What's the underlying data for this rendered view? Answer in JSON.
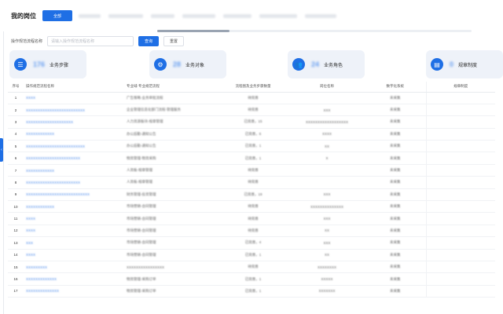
{
  "header": {
    "title": "我的岗位",
    "active_tab": "全部",
    "ghost_tabs": 7
  },
  "filter": {
    "label": "操作规范流程名称",
    "placeholder": "请输入操作规范流程名称",
    "query_label": "查询",
    "reset_label": "重置"
  },
  "cards": [
    {
      "label": "业务步骤",
      "number": "176",
      "icon": "steps-icon"
    },
    {
      "label": "业务对象",
      "number": "28",
      "icon": "object-icon"
    },
    {
      "label": "业务角色",
      "number": "24",
      "icon": "role-icon"
    },
    {
      "label": "规章制度",
      "number": "0",
      "icon": "document-icon"
    }
  ],
  "table": {
    "columns": [
      "序号",
      "操作规范流程名称",
      "专业域-专业规范流程",
      "流程图及业务步骤数量",
      "岗位名称",
      "数字化系统",
      "规章制度"
    ],
    "rows": [
      {
        "index": "1",
        "name": "XXXX",
        "domain": "广告策略-业务审批流程",
        "steps": "待完善",
        "role": "",
        "system": "未采集",
        "rule": ""
      },
      {
        "index": "2",
        "name": "XXXXXXXXXXXXXXXXXXXXXXXXX",
        "domain": "企业管理信息化部门流程-管理服务",
        "steps": "待完善",
        "role": "XXX",
        "system": "未采集",
        "rule": ""
      },
      {
        "index": "3",
        "name": "XXXXXXXXXXXXXXXXXXXX",
        "domain": "人力资源板块-规章管理",
        "steps": "已完善，15",
        "role": "XXXXXXXXXXXXXXXXXX",
        "system": "未采集",
        "rule": ""
      },
      {
        "index": "4",
        "name": "XXXXXXXXXXXX",
        "domain": "办公后勤-通知公告",
        "steps": "已完善，6",
        "role": "XXXX",
        "system": "未采集",
        "rule": ""
      },
      {
        "index": "5",
        "name": "XXXXXXXXXXXXXXXXXXXXXXXXX",
        "domain": "办公后勤-通知公告",
        "steps": "已完善，1",
        "role": "XX",
        "system": "未采集",
        "rule": ""
      },
      {
        "index": "6",
        "name": "XXXXXXXXXXXXXXXXXXXXXXX",
        "domain": "物资管理-物资采购",
        "steps": "已完善，1",
        "role": "X",
        "system": "未采集",
        "rule": ""
      },
      {
        "index": "7",
        "name": "XXXXXXXXXXXX",
        "domain": "人资板-规章管理",
        "steps": "待完善",
        "role": "",
        "system": "未采集",
        "rule": ""
      },
      {
        "index": "8",
        "name": "XXXXXXXXXXXXXXXXXXXXXXX",
        "domain": "人资板-规章管理",
        "steps": "待完善",
        "role": "",
        "system": "未采集",
        "rule": ""
      },
      {
        "index": "9",
        "name": "XXXXXXXXXXXXXXXXXXXXXXXXXXX",
        "domain": "财务管理-投资管理",
        "steps": "已完善，19",
        "role": "XXX",
        "system": "未采集",
        "rule": ""
      },
      {
        "index": "10",
        "name": "XXXXXXXXXXXX",
        "domain": "市场营销-合同管理",
        "steps": "待完善",
        "role": "XXXXXXXXXXXXXX",
        "system": "未采集",
        "rule": ""
      },
      {
        "index": "11",
        "name": "XXXX",
        "domain": "市场营销-合同管理",
        "steps": "待完善",
        "role": "XXX",
        "system": "未采集",
        "rule": ""
      },
      {
        "index": "12",
        "name": "XXXX",
        "domain": "市场营销-合同管理",
        "steps": "待完善",
        "role": "XX",
        "system": "未采集",
        "rule": ""
      },
      {
        "index": "13",
        "name": "XXX",
        "domain": "市场营销-合同管理",
        "steps": "已完善，4",
        "role": "XXX",
        "system": "未采集",
        "rule": ""
      },
      {
        "index": "14",
        "name": "XXXX",
        "domain": "市场营销-合同管理",
        "steps": "已完善，1",
        "role": "XX",
        "system": "未采集",
        "rule": ""
      },
      {
        "index": "15",
        "name": "XXXXXXXXX",
        "domain": "XXXXXXXXXXXXXXXX",
        "steps": "待完善",
        "role": "XXXXXXXX",
        "system": "未采集",
        "rule": ""
      },
      {
        "index": "16",
        "name": "XXXXXXXXXXXXX",
        "domain": "物资管理-采购订单",
        "steps": "已完善，1",
        "role": "XXXXX",
        "system": "未采集",
        "rule": ""
      },
      {
        "index": "17",
        "name": "XXXXXXXXXXXXXX",
        "domain": "物资管理-采购订单",
        "steps": "已完善，1",
        "role": "XXXXXXX",
        "system": "未采集",
        "rule": ""
      }
    ]
  },
  "colors": {
    "primary": "#1f6fe5",
    "card_bg": "#eef2f9",
    "link": "#4a88ea"
  }
}
